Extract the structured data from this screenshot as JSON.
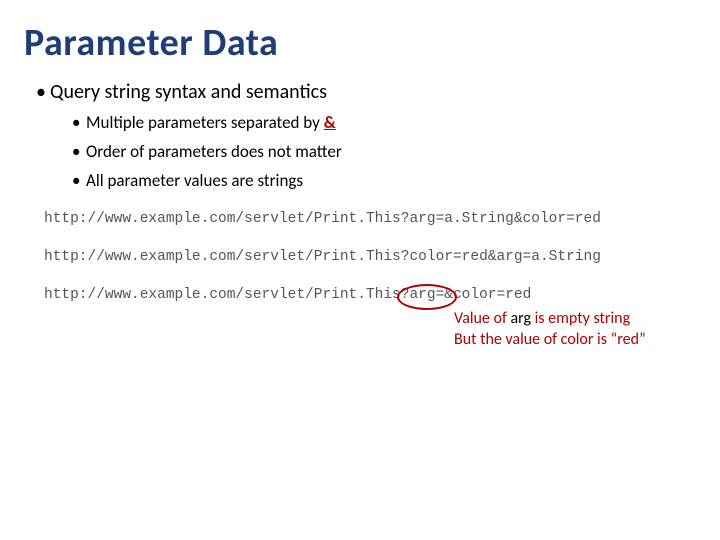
{
  "title": "Parameter Data",
  "bullets": {
    "main": "Query string syntax and semantics",
    "sub": [
      {
        "prefix": "Multiple parameters separated by ",
        "amp": "&"
      },
      {
        "text": "Order of parameters does not matter"
      },
      {
        "text": "All parameter values are strings"
      }
    ]
  },
  "urls": {
    "a": "http://www.example.com/servlet/Print.This?arg=a.String&color=red",
    "b": "http://www.example.com/servlet/Print.This?color=red&arg=a.String",
    "c_pre": "http://www.example.com/servlet/Print.This",
    "c_circle": "?arg=",
    "c_post": "&color=red"
  },
  "annotation": {
    "line1_a": "Value of ",
    "line1_b": "arg",
    "line1_c": " is empty string",
    "line2": "But the value of color is “red”"
  }
}
